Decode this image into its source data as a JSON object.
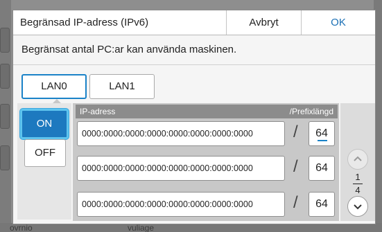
{
  "dialog": {
    "title": "Begränsad IP-adress (IPv6)",
    "cancel_label": "Avbryt",
    "ok_label": "OK",
    "description": "Begränsat antal PC:ar kan använda maskinen."
  },
  "lan_tabs": [
    {
      "label": "LAN0",
      "active": true
    },
    {
      "label": "LAN1",
      "active": false
    }
  ],
  "toggle": {
    "on_label": "ON",
    "off_label": "OFF",
    "selected": "ON"
  },
  "list": {
    "col_ip": "IP-adress",
    "col_prefix": "/Prefixlängd",
    "slash": "/",
    "rows": [
      {
        "ip": "0000:0000:0000:0000:0000:0000:0000:0000",
        "prefix": "64"
      },
      {
        "ip": "0000:0000:0000:0000:0000:0000:0000:0000",
        "prefix": "64"
      },
      {
        "ip": "0000:0000:0000:0000:0000:0000:0000:0000",
        "prefix": "64"
      }
    ]
  },
  "pagination": {
    "current": "1",
    "total": "4"
  },
  "icons": {
    "up": "chevron-up-icon",
    "down": "chevron-down-icon"
  },
  "colors": {
    "accent": "#1d79bf",
    "focus_ring": "#5ec4ee",
    "ok_text": "#1a6fb5"
  },
  "background": {
    "left_text": "ovrnio",
    "mid_text": "vuliage"
  }
}
